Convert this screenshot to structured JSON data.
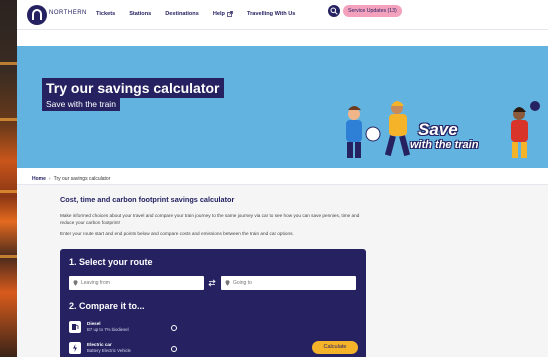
{
  "brand": {
    "name": "NORTHERN"
  },
  "nav": {
    "items": [
      {
        "label": "Tickets"
      },
      {
        "label": "Stations"
      },
      {
        "label": "Destinations"
      },
      {
        "label": "Help",
        "external": true
      },
      {
        "label": "Travelling With Us"
      }
    ],
    "search_icon": "search-icon",
    "service_updates_label": "Service Updates (13)"
  },
  "hero": {
    "title": "Try our savings calculator",
    "subtitle": "Save with the train",
    "badge_line1": "Save",
    "badge_line2": "with the train"
  },
  "breadcrumb": {
    "home": "Home",
    "separator": "›",
    "current": "Try our savings calculator"
  },
  "page": {
    "title": "Cost, time and carbon footprint savings calculator",
    "intro": "Make informed choices about your travel and compare your train journey to the same journey via car to see how you can save pennies, time and reduce your carbon footprint!",
    "instructions": "Enter your route start and end points below and compare costs and emissions between the train and car options."
  },
  "calculator": {
    "step1_title": "1. Select your route",
    "from_placeholder": "Leaving from",
    "to_placeholder": "Going to",
    "step2_title": "2. Compare it to...",
    "options": [
      {
        "name": "Diesel",
        "description": "B7 up to 7% biodiesel"
      },
      {
        "name": "Electric car",
        "description": "Battery Electric Vehicle"
      }
    ],
    "calculate_label": "Calculate"
  },
  "colors": {
    "brand_navy": "#262262",
    "hero_blue": "#62b3df",
    "accent_green": "#88c65c",
    "service_pink": "#f3a1bd",
    "button_yellow": "#f5b32a"
  }
}
